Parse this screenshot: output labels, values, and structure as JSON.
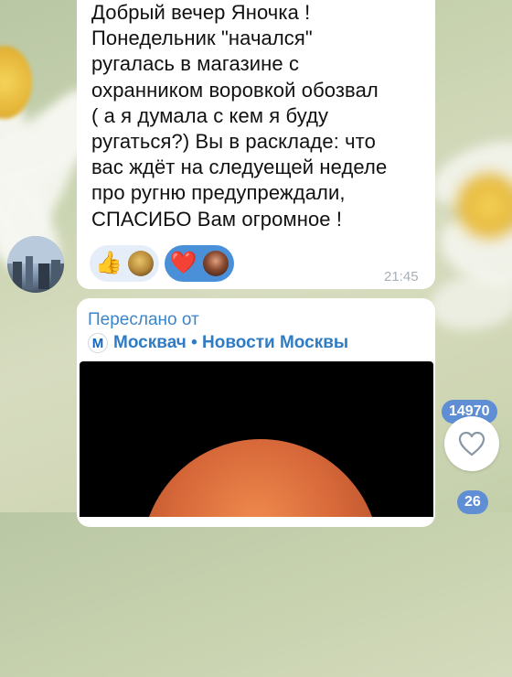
{
  "message": {
    "text": "Добрый вечер Яночка !\nПонедельник \"начался\"\nругалась в магазине с\nохранником воровкой обозвал\n( а я думала с кем я буду\nругаться?) Вы в раскладе: что\nвас ждёт на следуещей неделе\nпро ругню предупреждали,\nСПАСИБО Вам огромное !",
    "time": "21:45",
    "reactions": [
      {
        "emoji": "👍",
        "selected": false
      },
      {
        "emoji": "❤️",
        "selected": true
      }
    ]
  },
  "forwarded": {
    "label": "Переслано от",
    "channel_icon": "М",
    "channel_name": "Москвач • Новости Москвы"
  },
  "side_actions": {
    "views_count": "14970",
    "comments_count": "26"
  },
  "colors": {
    "accent": "#3b86c9",
    "reaction_selected": "#4a90d9",
    "badge": "#5f8ed4"
  }
}
